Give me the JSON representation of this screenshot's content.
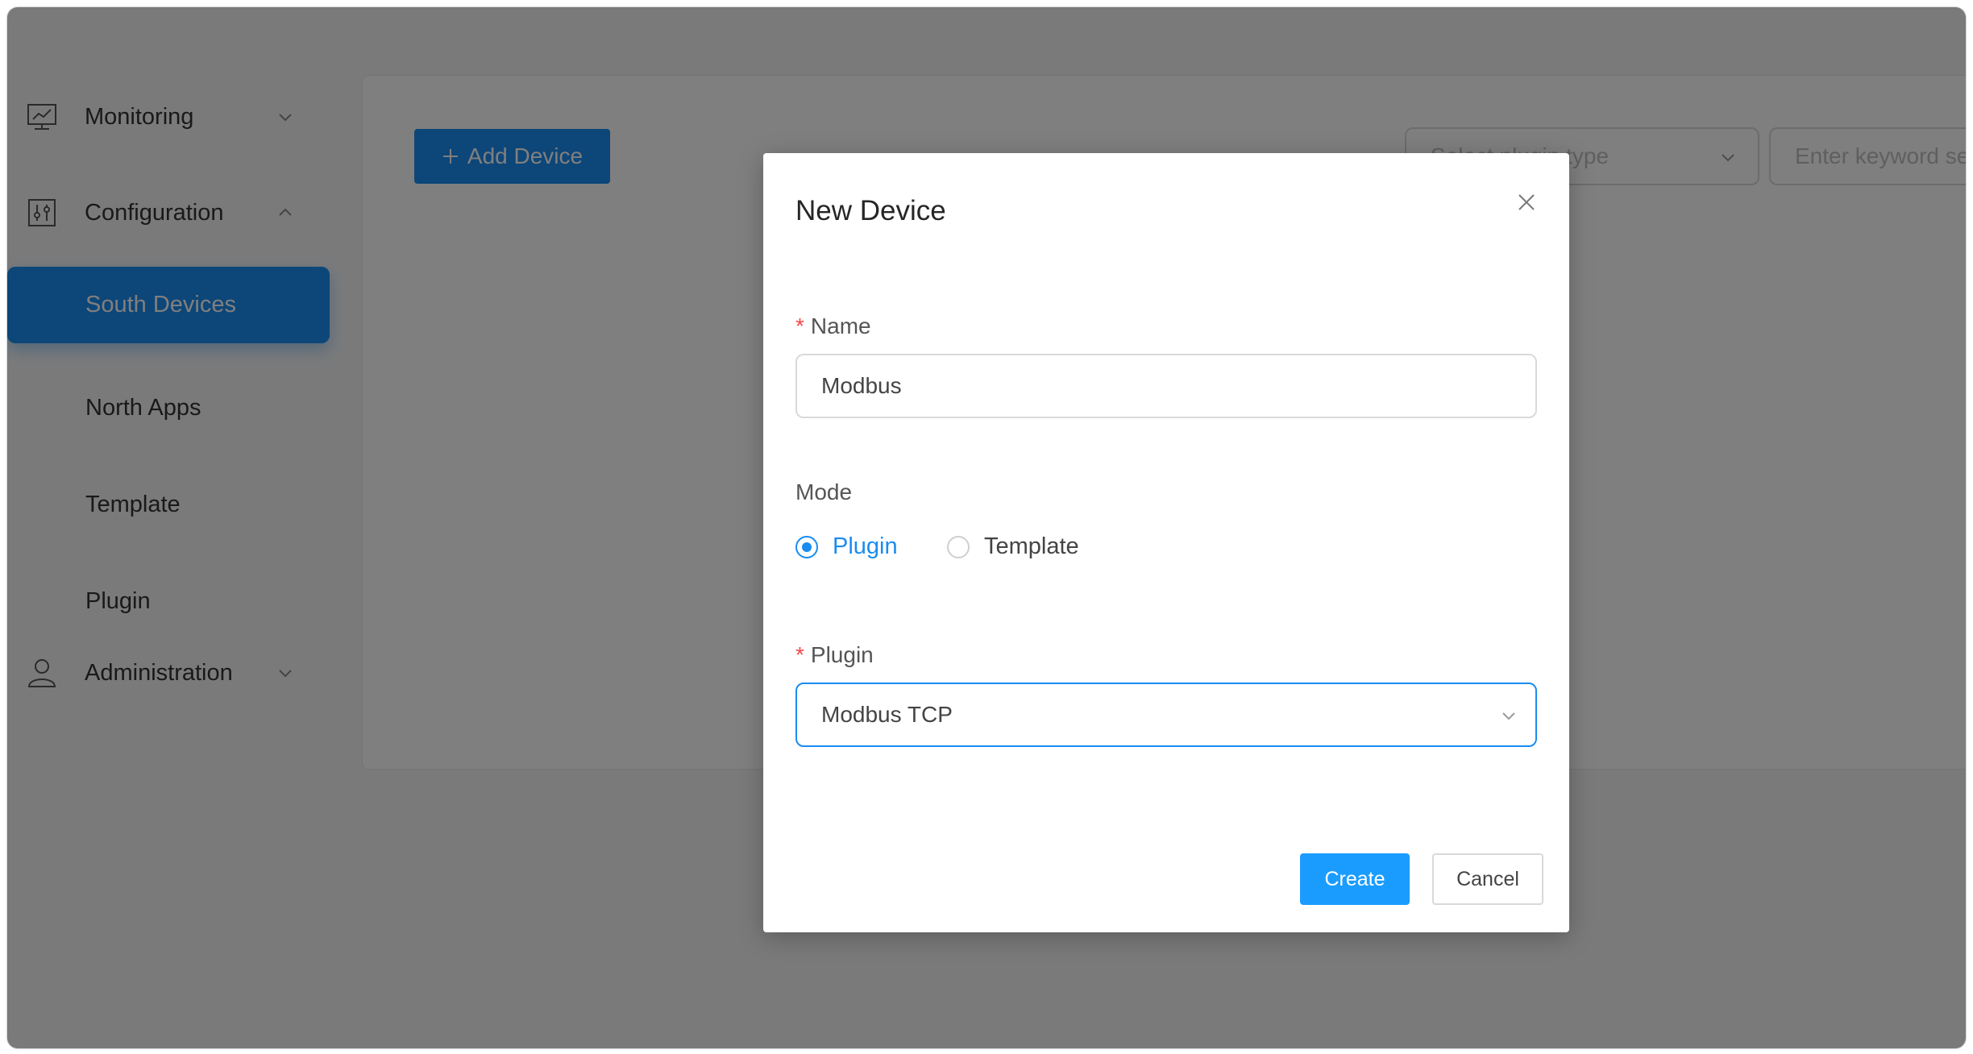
{
  "sidebar": {
    "monitoring": {
      "label": "Monitoring",
      "icon": "chart-monitor-icon"
    },
    "configuration": {
      "label": "Configuration",
      "icon": "sliders-icon"
    },
    "items": [
      {
        "label": "South Devices",
        "active": true
      },
      {
        "label": "North Apps"
      },
      {
        "label": "Template"
      },
      {
        "label": "Plugin"
      }
    ],
    "administration": {
      "label": "Administration",
      "icon": "user-icon"
    }
  },
  "main": {
    "add_device_label": "Add Device",
    "plugin_type_placeholder": "Select plugin type",
    "keyword_placeholder": "Enter keyword sea"
  },
  "modal": {
    "title": "New Device",
    "name": {
      "label": "Name",
      "value": "Modbus",
      "required": true
    },
    "mode": {
      "label": "Mode",
      "options": [
        {
          "label": "Plugin",
          "checked": true
        },
        {
          "label": "Template",
          "checked": false
        }
      ]
    },
    "plugin": {
      "label": "Plugin",
      "value": "Modbus TCP",
      "required": true
    },
    "create_label": "Create",
    "cancel_label": "Cancel"
  },
  "colors": {
    "accent": "#1a8cf0",
    "required": "#f5474a",
    "overlay": "rgba(0,0,0,0.5)"
  }
}
